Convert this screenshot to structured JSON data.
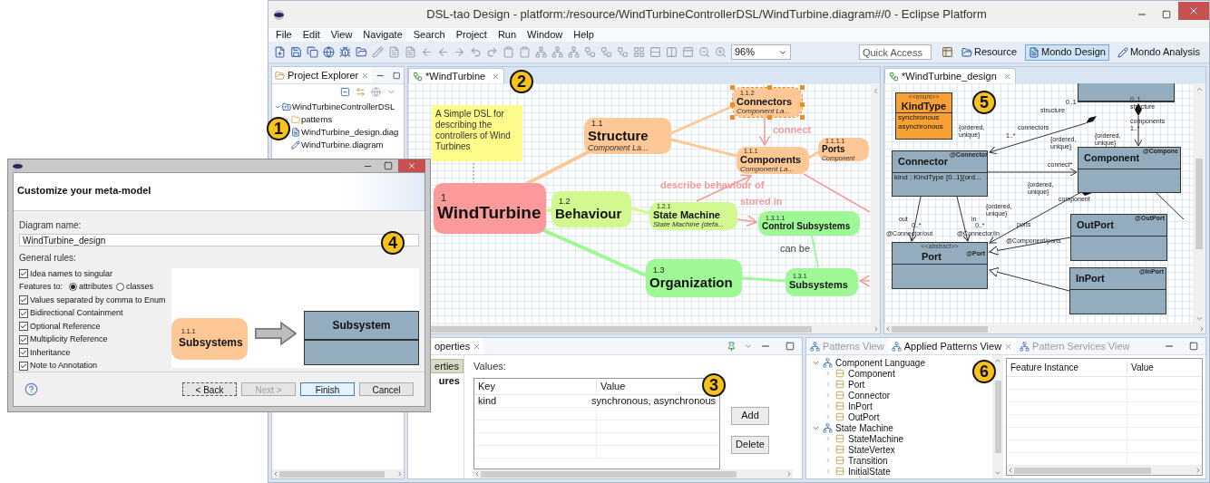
{
  "window": {
    "title": "DSL-tao Design - platform:/resource/WindTurbineControllerDSL/WindTurbine.diagram#/0 - Eclipse Platform"
  },
  "menu": [
    "File",
    "Edit",
    "View",
    "Navigate",
    "Search",
    "Project",
    "Run",
    "Window",
    "Help"
  ],
  "toolbar": {
    "zoom": "96%",
    "quick_access_placeholder": "Quick Access",
    "perspectives": [
      {
        "label": "Resource",
        "selected": false,
        "kind": "resource"
      },
      {
        "label": "Mondo Design",
        "selected": true,
        "kind": "design"
      },
      {
        "label": "Mondo Analysis",
        "selected": false,
        "kind": "analysis"
      }
    ]
  },
  "project_explorer": {
    "title": "Project Explorer",
    "tree": [
      {
        "label": "WindTurbineControllerDSL",
        "kind": "project",
        "expanded": true,
        "children": [
          {
            "label": "patterns",
            "kind": "folder",
            "expanded": false
          },
          {
            "label": "WindTurbine_design.diag",
            "kind": "design"
          },
          {
            "label": "WindTurbine.diagram",
            "kind": "diagram"
          }
        ]
      }
    ]
  },
  "mindmap_editor": {
    "tab": "*WindTurbine",
    "note": "A Simple DSL for describing the controllers of Wind Turbines",
    "nodes": [
      {
        "number": "1",
        "title": "WindTurbine",
        "color": "#fa9a9a",
        "selected": false,
        "children": [
          {
            "number": "1.1",
            "title": "Structure",
            "subtitle": "Component La...",
            "color": "#fdc896",
            "selected": false,
            "children": [
              {
                "number": "1.1.2",
                "title": "Connectors",
                "subtitle": "Component La...",
                "color": "#fdc896",
                "selected": true
              },
              {
                "number": "1.1.1",
                "title": "Components",
                "subtitle": "Component La...",
                "color": "#fdc896",
                "selected": false,
                "children": [
                  {
                    "number": "1.1.1.1",
                    "title": "Ports",
                    "subtitle": "Component",
                    "color": "#fdc896",
                    "selected": false
                  }
                ]
              }
            ]
          },
          {
            "number": "1.2",
            "title": "Behaviour",
            "color": "#d2f98f",
            "selected": false,
            "children": [
              {
                "number": "1.2.1",
                "title": "State Machine",
                "subtitle": "State Machine (defa...",
                "color": "#d2f98f",
                "selected": false
              }
            ]
          },
          {
            "number": "1.3",
            "title": "Organization",
            "color": "#9df895",
            "selected": false,
            "children": [
              {
                "number": "1.3.1",
                "title": "Subsystems",
                "color": "#9df895",
                "selected": false,
                "children": [
                  {
                    "number": "1.3.1.1",
                    "title": "Control Subsystems",
                    "color": "#9df895",
                    "selected": false
                  }
                ]
              }
            ]
          }
        ]
      }
    ],
    "edge_labels": [
      {
        "text": "connect",
        "kind": "relation"
      },
      {
        "text": "describe behaviour of",
        "kind": "relation"
      },
      {
        "text": "stored in",
        "kind": "relation"
      },
      {
        "text": "can be",
        "kind": "comment"
      }
    ]
  },
  "design_editor": {
    "tab": "*WindTurbine_design",
    "classes": [
      {
        "kind": "enum",
        "stereotype": "<<enum>>",
        "name": "KindType",
        "items": [
          "synchronous",
          "asynchronous"
        ]
      },
      {
        "kind": "class",
        "name": "Connector",
        "annotation": "@Connector",
        "items": [
          "kind : KindType [0..1]{ord..."
        ]
      },
      {
        "kind": "class",
        "name": "Component",
        "annotation": "@Compone"
      },
      {
        "kind": "class",
        "stereotype": "<<abstract>>",
        "name": "Port",
        "annotation": "@Port"
      },
      {
        "kind": "class",
        "name": "OutPort",
        "annotation": "@OutPort"
      },
      {
        "kind": "class",
        "name": "InPort",
        "annotation": "@InPort"
      },
      {
        "kind": "class"
      }
    ],
    "labels": [
      {
        "text": "0..1",
        "kind": "role"
      },
      {
        "text": "structure",
        "kind": "role"
      },
      {
        "text": "0..1",
        "kind": "role"
      },
      {
        "text": "structure",
        "kind": "role"
      },
      {
        "text": "{ordered, unique}",
        "kind": "constraint"
      },
      {
        "text": "connectors",
        "kind": "role"
      },
      {
        "text": "1..*",
        "kind": "role"
      },
      {
        "text": "components",
        "kind": "role"
      },
      {
        "text": "1..*",
        "kind": "role"
      },
      {
        "text": "{ordered, unique}",
        "kind": "constraint"
      },
      {
        "text": "{ordered, unique}",
        "kind": "constraint"
      },
      {
        "text": "connect*",
        "kind": "role"
      },
      {
        "text": "{ordered, unique}",
        "kind": "constraint"
      },
      {
        "text": "component",
        "kind": "role"
      },
      {
        "text": "{ordered, unique}",
        "kind": "constraint"
      },
      {
        "text": "ports",
        "kind": "role"
      },
      {
        "text": "out",
        "kind": "role"
      },
      {
        "text": "0..*",
        "kind": "role"
      },
      {
        "text": "@Connector/out",
        "kind": "role"
      },
      {
        "text": "in",
        "kind": "role"
      },
      {
        "text": "0..*",
        "kind": "role"
      },
      {
        "text": "@Connector/in",
        "kind": "role"
      },
      {
        "text": "@Component/ports",
        "kind": "role"
      }
    ]
  },
  "properties": {
    "tab": "operties",
    "side_tabs": [
      {
        "label": "erties",
        "selected": true
      },
      {
        "label": "ures",
        "selected": false
      }
    ],
    "group": "Values:",
    "columns": [
      "Key",
      "Value"
    ],
    "rows": [
      [
        "kind",
        "synchronous, asynchronous"
      ]
    ],
    "buttons": [
      "Add",
      "Delete"
    ]
  },
  "patterns": {
    "tabs": [
      {
        "label": "Patterns View",
        "selected": false
      },
      {
        "label": "Applied Patterns View",
        "selected": true
      },
      {
        "label": "Pattern Services View",
        "selected": false
      }
    ],
    "tree": [
      {
        "label": "Component Language",
        "expanded": true,
        "children": [
          {
            "label": "Component",
            "expanded": false
          },
          {
            "label": "Port",
            "expanded": false
          },
          {
            "label": "Connector",
            "expanded": false
          },
          {
            "label": "InPort",
            "expanded": false
          },
          {
            "label": "OutPort",
            "expanded": false
          }
        ]
      },
      {
        "label": "State Machine",
        "expanded": true,
        "children": [
          {
            "label": "StateMachine",
            "expanded": false
          },
          {
            "label": "StateVertex",
            "expanded": false
          },
          {
            "label": "Transition",
            "expanded": false
          },
          {
            "label": "InitialState",
            "expanded": false
          }
        ]
      }
    ],
    "columns": [
      "Feature Instance",
      "Value"
    ]
  },
  "dialog": {
    "header": "Customize your meta-model",
    "name_label": "Diagram name:",
    "name_value": "WindTurbine_design",
    "rules_label": "General rules:",
    "rules": [
      {
        "kind": "checkbox",
        "label": "Idea names to singular",
        "checked": true
      },
      {
        "kind": "radio_group",
        "label": "Features to:",
        "options": [
          {
            "label": "attributes",
            "selected": true
          },
          {
            "label": "classes",
            "selected": false
          }
        ]
      },
      {
        "kind": "checkbox",
        "label": "Values separated by comma to Enum",
        "checked": true
      },
      {
        "kind": "checkbox",
        "label": "Bidirectional Containment",
        "checked": true
      },
      {
        "kind": "checkbox",
        "label": "Optional Reference",
        "checked": true
      },
      {
        "kind": "checkbox",
        "label": "Multiplicity Reference",
        "checked": true
      },
      {
        "kind": "checkbox",
        "label": "Inheritance",
        "checked": true
      },
      {
        "kind": "checkbox",
        "label": "Note to Annotation",
        "checked": true
      }
    ],
    "preview": {
      "node_number": "1.1.1",
      "node_title": "Subsystems",
      "class_name": "Subsystem"
    },
    "buttons": [
      {
        "label": "< Back",
        "kind": "focused",
        "disabled": false
      },
      {
        "label": "Next >",
        "kind": "normal",
        "disabled": true
      },
      {
        "label": "Finish",
        "kind": "default",
        "disabled": false
      },
      {
        "label": "Cancel",
        "kind": "normal",
        "disabled": false
      }
    ]
  },
  "callouts": [
    "1",
    "2",
    "3",
    "4",
    "5",
    "6"
  ]
}
